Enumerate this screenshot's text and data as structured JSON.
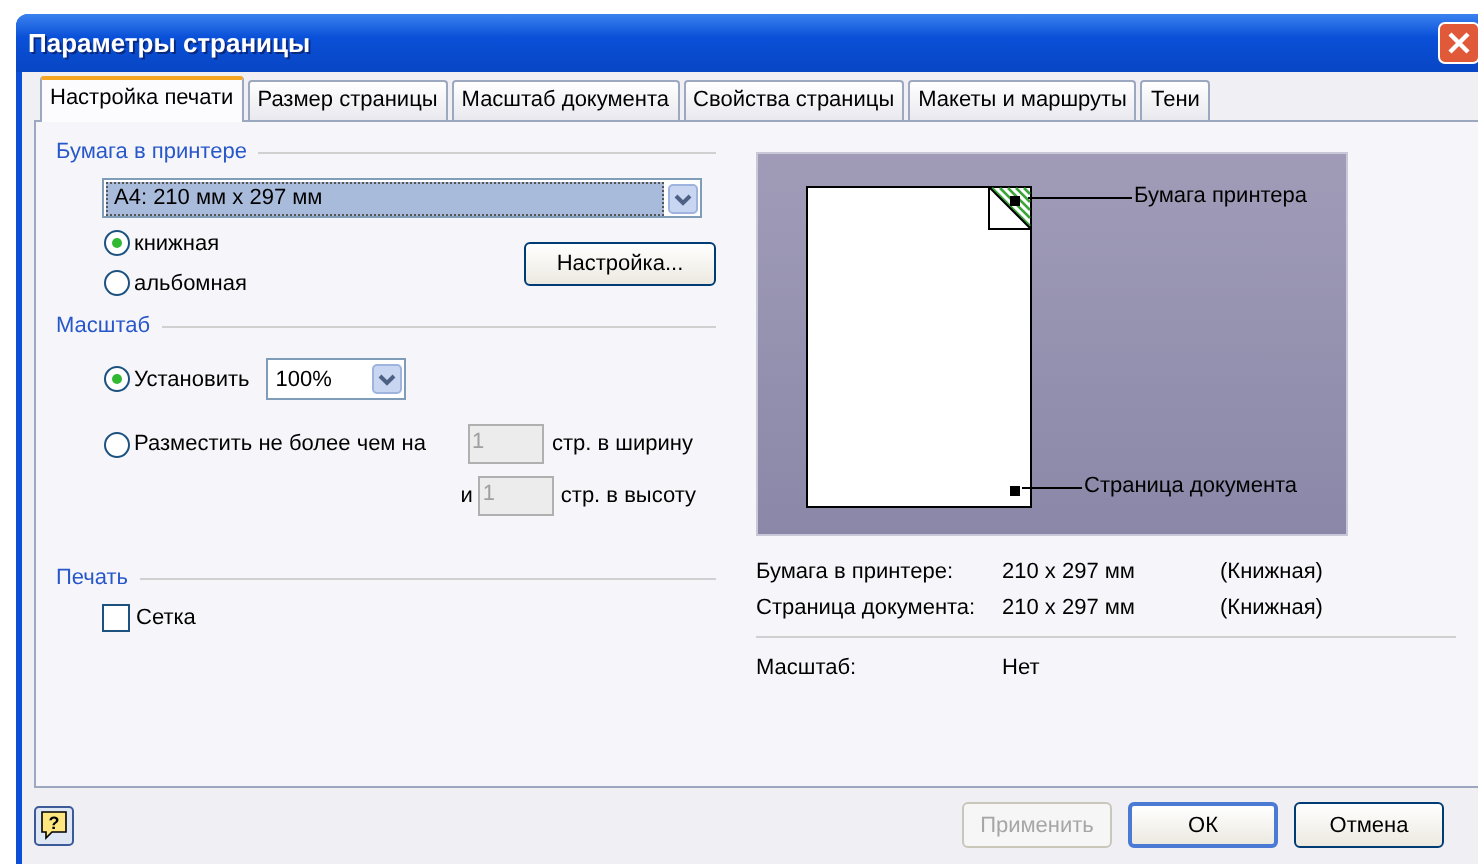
{
  "window": {
    "title": "Параметры страницы"
  },
  "tabs": [
    {
      "label": "Настройка печати",
      "selected": true
    },
    {
      "label": "Размер страницы",
      "selected": false
    },
    {
      "label": "Масштаб документа",
      "selected": false
    },
    {
      "label": "Свойства страницы",
      "selected": false
    },
    {
      "label": "Макеты и маршруты",
      "selected": false
    },
    {
      "label": "Тени",
      "selected": false
    }
  ],
  "paper": {
    "group": "Бумага в принтере",
    "size": "A4:  210 мм x 297 мм",
    "orientation": [
      {
        "label": "книжная",
        "selected": true
      },
      {
        "label": "альбомная",
        "selected": false
      }
    ],
    "setup_button": "Настройка..."
  },
  "scale": {
    "group": "Масштаб",
    "set": {
      "label": "Установить",
      "selected": true,
      "value": "100%"
    },
    "fit": {
      "label": "Разместить не более чем на",
      "selected": false,
      "width_pages": "1",
      "width_unit": "стр. в ширину",
      "and": "и",
      "height_pages": "1",
      "height_unit": "стр. в высоту"
    }
  },
  "print": {
    "group": "Печать",
    "grid": {
      "label": "Сетка",
      "checked": false
    }
  },
  "preview": {
    "paper_label": "Бумага принтера",
    "page_label": "Страница документа"
  },
  "info": [
    {
      "label": "Бумага в принтере:",
      "size": "210 x 297 мм",
      "orientation": "(Книжная)"
    },
    {
      "label": "Страница документа:",
      "size": "210 x 297 мм",
      "orientation": "(Книжная)"
    }
  ],
  "info_scale": {
    "label": "Масштаб:",
    "value": "Нет"
  },
  "help": "?",
  "buttons": [
    {
      "label": "Применить",
      "disabled": true
    },
    {
      "label": "ОК",
      "disabled": false
    },
    {
      "label": "Отмена",
      "disabled": false
    }
  ]
}
